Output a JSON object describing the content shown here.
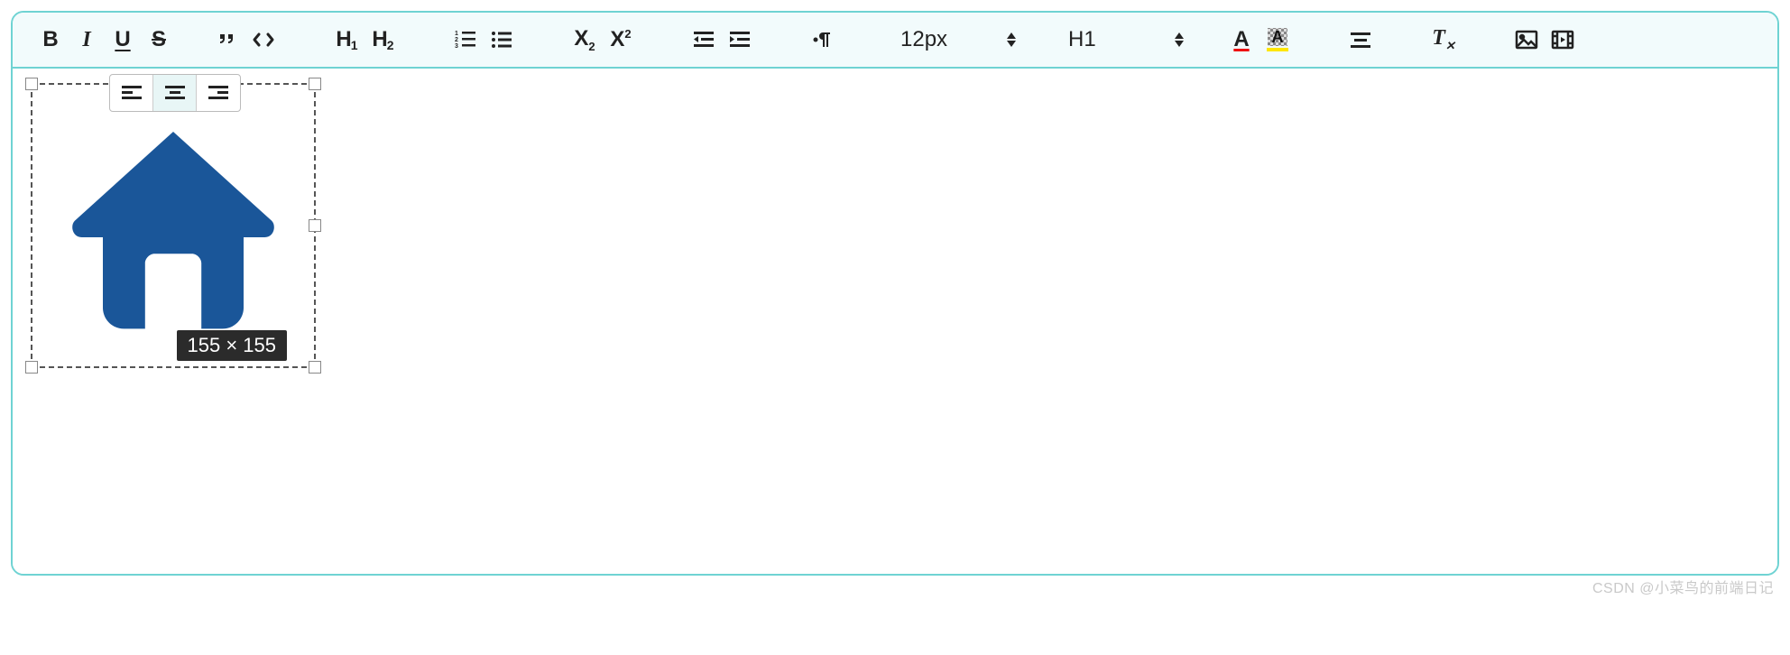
{
  "toolbar": {
    "bold": "B",
    "italic": "I",
    "underline": "U",
    "strike": "S",
    "h1": "H1",
    "h2": "H2",
    "subscript_base": "X",
    "subscript_small": "2",
    "superscript_base": "X",
    "superscript_small": "2",
    "font_size": "12px",
    "heading_select": "H1"
  },
  "image": {
    "dim_label": "155 × 155",
    "align_left": "left",
    "align_center": "center",
    "align_right": "right"
  },
  "watermark": "CSDN @小菜鸟的前端日记"
}
